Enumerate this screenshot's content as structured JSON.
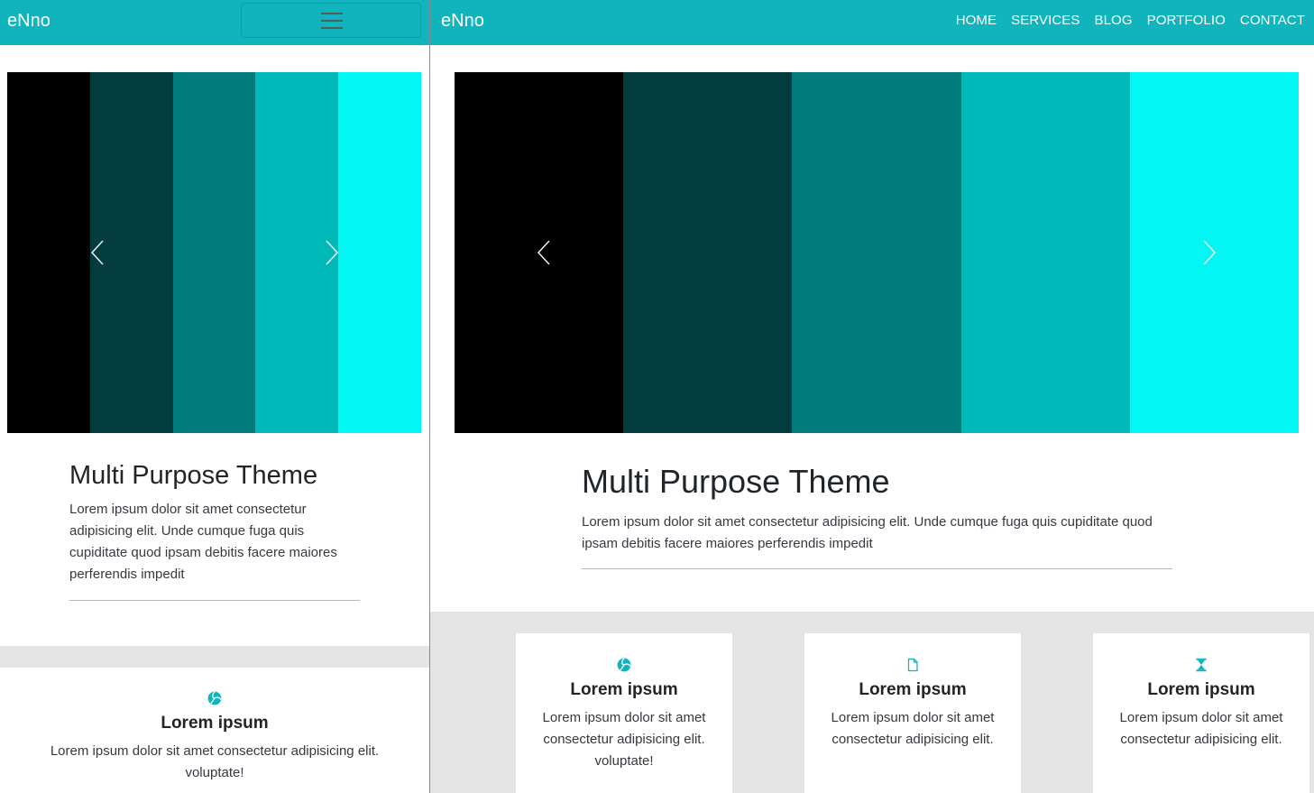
{
  "colors": {
    "navbar": "#10b4bc",
    "nav_text": "#ffffff",
    "services_bg": "#e4e4e4",
    "card_bg": "#ffffff",
    "icon": "#10b4bc",
    "carousel_stripes": [
      "#000000",
      "#023c3c",
      "#017b7b",
      "#00b8b8",
      "#00f7f4"
    ]
  },
  "mobile": {
    "brand": "eNno",
    "hero": {
      "title": "Multi Purpose Theme",
      "text": "Lorem ipsum dolor sit amet consectetur adipisicing elit. Unde cumque fuga quis cupiditate quod ipsam debitis facere maiores perferendis impedit"
    },
    "card": {
      "icon": "volleyball-icon",
      "title": "Lorem ipsum",
      "text": "Lorem ipsum dolor sit amet consectetur adipisicing elit. voluptate!"
    }
  },
  "desktop": {
    "brand": "eNno",
    "nav": [
      "HOME",
      "SERVICES",
      "BLOG",
      "PORTFOLIO",
      "CONTACT"
    ],
    "hero": {
      "title": "Multi Purpose Theme",
      "text": "Lorem ipsum dolor sit amet consectetur adipisicing elit. Unde cumque fuga quis cupiditate quod ipsam debitis facere maiores perferendis impedit"
    },
    "cards": [
      {
        "icon": "volleyball-icon",
        "title": "Lorem ipsum",
        "text": "Lorem ipsum dolor sit amet consectetur adipisicing elit. voluptate!"
      },
      {
        "icon": "file-icon",
        "title": "Lorem ipsum",
        "text": "Lorem ipsum dolor sit amet consectetur adipisicing elit."
      },
      {
        "icon": "hourglass-icon",
        "title": "Lorem ipsum",
        "text": "Lorem ipsum dolor sit amet consectetur adipisicing elit."
      }
    ]
  }
}
